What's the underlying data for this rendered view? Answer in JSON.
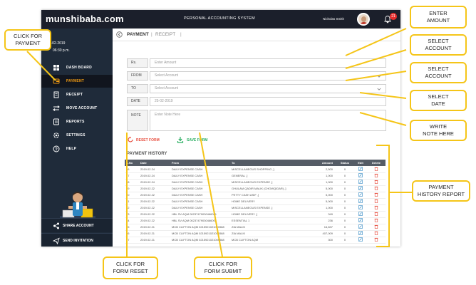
{
  "topbar": {
    "brand_part1": "munshi",
    "brand_part2": "baba",
    "brand_part3": ".com",
    "system_title": "PERSONAL ACCOUNTING SYSTEM",
    "user_name": "Nicholas Smith",
    "notification_count": "21"
  },
  "sidebar": {
    "date_line1": "y  08-02-2019",
    "date_line2": "06:30 p.m.",
    "items": [
      {
        "label": "DASH BOARD",
        "icon": "dashboard-icon"
      },
      {
        "label": "PAYMENT",
        "icon": "payment-icon"
      },
      {
        "label": "RECEIPT",
        "icon": "receipt-icon"
      },
      {
        "label": "MOVE ACCOUNT",
        "icon": "move-account-icon"
      },
      {
        "label": "REPORTS",
        "icon": "reports-icon"
      },
      {
        "label": "SETTINGS",
        "icon": "settings-icon"
      },
      {
        "label": "HELP",
        "icon": "help-icon"
      }
    ],
    "active_item": "PAYMENT",
    "share_account": "SHARE ACCOUNT",
    "send_invitation": "SEND INVITATION"
  },
  "main": {
    "tab_payment": "PAYMENT",
    "tab_sep": "|",
    "tab_receipt": "RECEIPT",
    "form": {
      "rs_label": "Rs.",
      "amount_placeholder": "Enter Amount",
      "from_label": "FROM",
      "from_placeholder": "Select Account",
      "to_label": "TO",
      "to_placeholder": "Select Account",
      "date_label": "DATE",
      "date_value": "25-02-2019",
      "note_label": "NOTE",
      "note_placeholder": "Enter Note Here"
    },
    "reset_label": "RESET FORM",
    "save_label": "SAVE FORM",
    "history_title": "PAYMENT HISTORY",
    "history_columns": [
      "S.No",
      "Date",
      "From",
      "To",
      "Amount",
      "Status",
      "Edit",
      "Delete"
    ],
    "history_rows": [
      {
        "sno": "26",
        "date": "2019.02.24",
        "from": "DAILY EXPENSE CASH",
        "to": "MISCELLANEOUS SHOPPING ,]",
        "amount": "2,500",
        "status": "0"
      },
      {
        "sno": "27",
        "date": "2019.02.24",
        "from": "DAILY EXPENSE CASH",
        "to": "GENERAL ,]",
        "amount": "1,000",
        "status": "0"
      },
      {
        "sno": "28",
        "date": "2019.02.24",
        "from": "DAILY EXPENSE CASH",
        "to": "MISCELLANEOUS EXPENSE ,]",
        "amount": "1,000",
        "status": "0"
      },
      {
        "sno": "29",
        "date": "2019.02.22",
        "from": "DAILY EXPENSE CASH",
        "to": "GHULAM QADIR MALIK (CHOWQIDAR) ,]",
        "amount": "5,000",
        "status": "0"
      },
      {
        "sno": "30",
        "date": "2019.02.22",
        "from": "DAILY EXPENSE CASH",
        "to": "PETTY CASH ASIF ,]",
        "amount": "5,000",
        "status": "0"
      },
      {
        "sno": "31",
        "date": "2019.02.22",
        "from": "DAILY EXPENSE CASH",
        "to": "HOME DELIVERY",
        "amount": "5,000",
        "status": "0"
      },
      {
        "sno": "32",
        "date": "2019.02.22",
        "from": "DAILY EXPENSE CASH",
        "to": "MISCELLANEOUS EXPENSE ,]",
        "amount": "1,000",
        "status": "0"
      },
      {
        "sno": "33",
        "date": "2019.02.22",
        "from": "HBL SV AQM 00237479030466001",
        "to": "HOME DELIVERY ,]",
        "amount": "349",
        "status": "0"
      },
      {
        "sno": "34",
        "date": "2019.02.22",
        "from": "HBL SV AQM 00237479030466001",
        "to": "ESSENTIAL 1",
        "amount": "236",
        "status": "0"
      },
      {
        "sno": "35",
        "date": "2019.02.21",
        "from": "MCB CLIFTON AQM 0215921021000588",
        "to": "ZIA MALIK",
        "amount": "16,837",
        "status": "0"
      },
      {
        "sno": "36",
        "date": "2019.02.21",
        "from": "MCB CLIFTON AQM 0215921021000588",
        "to": "ZIA MALIK",
        "amount": "407,009",
        "status": "0"
      },
      {
        "sno": "37",
        "date": "2019.02.21",
        "from": "MCB CLIFTON AQM 0215921021000588",
        "to": "MCB CLIFTON AQM",
        "amount": "300",
        "status": "0"
      }
    ]
  },
  "annotations": {
    "click_for_payment": "CLICK FOR\nPAYMENT",
    "enter_amount": "ENTER\nAMOUNT",
    "select_account_1": "SELECT\nACCOUNT",
    "select_account_2": "SELECT\nACCOUNT",
    "select_date": "SELECT\nDATE",
    "write_note": "WRITE\nNOTE HERE",
    "payment_history_report": "PAYMENT\nHISTORY REPORT",
    "click_form_reset": "CLICK FOR\nFORM RESET",
    "click_form_submit": "CLICK FOR\nFORM SUBMIT"
  },
  "colors": {
    "topbar_bg": "#1b1f2b",
    "sidebar_bg": "#1f2b3a",
    "active_accent": "#f39c12",
    "callout_border": "#f5c518",
    "reset_color": "#e74c3c",
    "save_color": "#27ae60",
    "table_header_bg": "#555c66"
  }
}
